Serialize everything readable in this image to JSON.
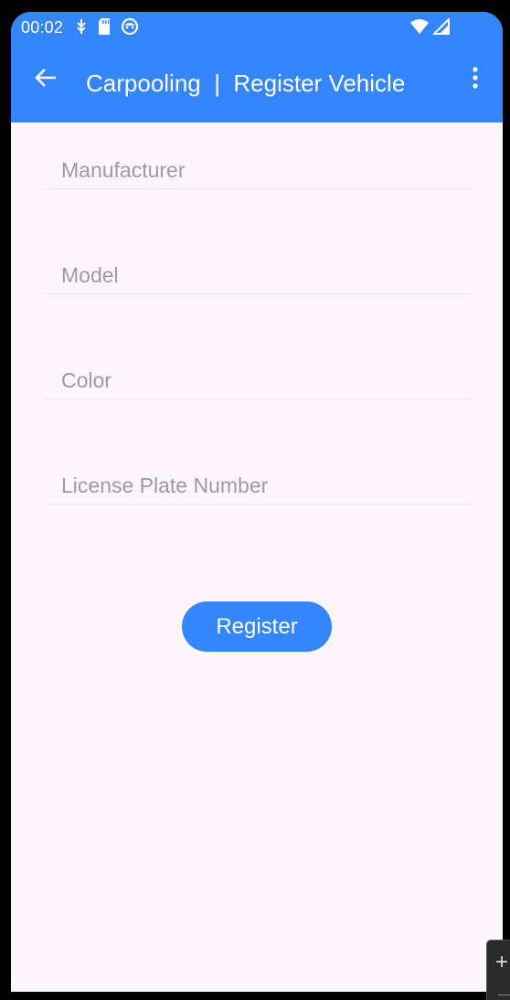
{
  "status_bar": {
    "time": "00:02",
    "left_icons": [
      "usb-debug-icon",
      "sd-card-icon",
      "app-notification-icon"
    ],
    "right_icons": [
      "wifi-icon",
      "cellular-signal-icon"
    ]
  },
  "app_bar": {
    "title": "Carpooling  |  Register Vehicle",
    "back_icon": "arrow-back-icon",
    "overflow_icon": "more-vert-icon",
    "color": "#3585fd"
  },
  "form": {
    "fields": [
      {
        "placeholder": "Manufacturer",
        "value": ""
      },
      {
        "placeholder": "Model",
        "value": ""
      },
      {
        "placeholder": "Color",
        "value": ""
      },
      {
        "placeholder": "License Plate Number",
        "value": ""
      }
    ],
    "submit_label": "Register"
  },
  "colors": {
    "accent": "#3585fd",
    "background": "#fdf6fd",
    "placeholder": "#9e9aa2"
  }
}
